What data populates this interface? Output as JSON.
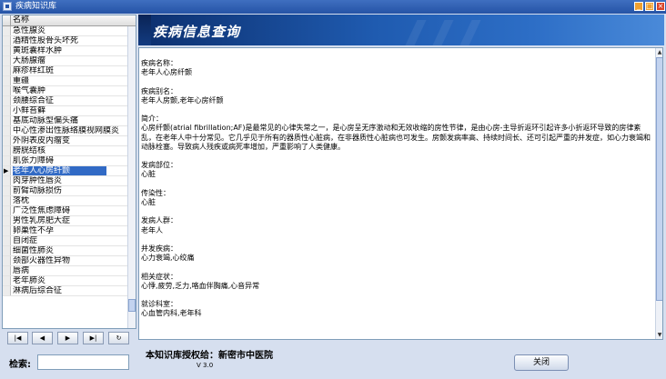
{
  "window": {
    "title": "疾病知识库",
    "icons": [
      "app-icon",
      "minimize-icon",
      "maximize-icon",
      "close-icon"
    ]
  },
  "list": {
    "header": "名称",
    "selected_index": 18,
    "items": [
      "急性腺炎",
      "酒精性股骨头坏死",
      "黄斑囊样水肿",
      "大肠腺瘤",
      "麻疹样红斑",
      "重疆",
      "喉气囊肿",
      "颈腰综合征",
      "小鲜苔藓",
      "基底动脉型偏头痛",
      "中心性渗出性脉络膜视网膜炎",
      "外阴表皮内瘤变",
      "膀胱结核",
      "肌张力障碍",
      "老年人心房纤颤",
      "肉芽肿性唇炎",
      "前臂动脉损伤",
      "落枕",
      "广泛性焦虑障碍",
      "男性乳房肥大症",
      "卵巢性不孕",
      "自闭症",
      "细菌性肺炎",
      "颈部火器性异物",
      "唇病",
      "老年肺炎",
      "淋病后综合征"
    ]
  },
  "nav_buttons": [
    "|◀",
    "◀",
    "▶",
    "▶|",
    "↻"
  ],
  "search": {
    "label": "检索:",
    "value": ""
  },
  "banner": {
    "title": "疾病信息查询"
  },
  "detail": {
    "text": "疾病名称：\n老年人心房纤颤\n\n疾病别名：\n老年人房颤,老年心房纤颤\n\n简介：\n心房纤颤(atrial fibrillation;AF)是最常见的心律失常之一，是心房呈无序激动和无效收缩的房性节律，是由心房-主导折返环引起许多小折返环导致的房律紊乱，在老年人中十分常见。它几乎见于所有的器质性心脏病，在非器质性心脏病也可发生。房颤发病率高、持续时间长、还可引起严重的并发症，如心力衰竭和动脉栓塞。导致病人残疾或病死率增加，严重影响了人类健康。\n\n发病部位：\n心脏\n\n传染性：\n心脏\n\n发病人群：\n老年人\n\n并发疾病：\n心力衰竭,心绞痛\n\n相关症状：\n心悸,疲劳,乏力,咯血伴胸痛,心音异常\n\n就诊科室：\n心血管内科,老年科"
  },
  "footer": {
    "authorization": "本知识库授权给：新密市中医院",
    "version": "V 3.0",
    "close_label": "关闭"
  }
}
